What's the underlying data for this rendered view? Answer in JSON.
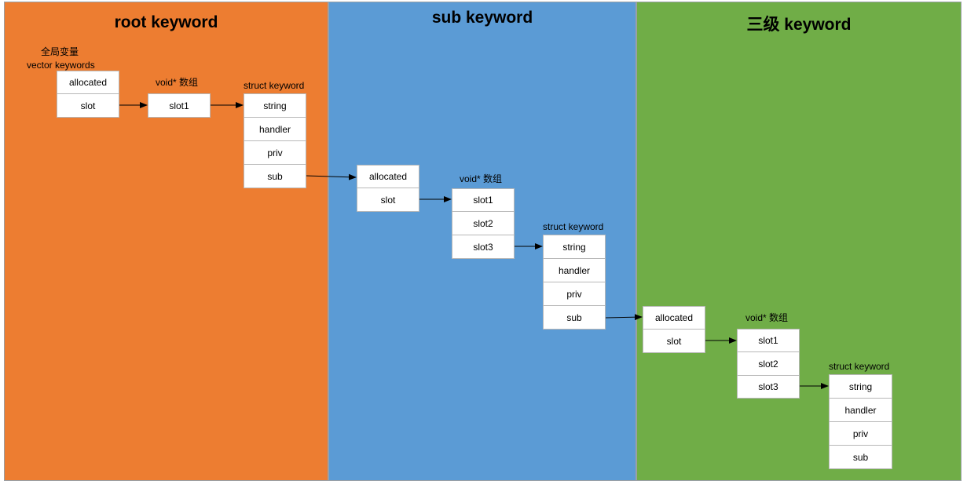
{
  "panels": {
    "root": {
      "title": "root keyword",
      "color": "#ed7d31"
    },
    "sub": {
      "title": "sub keyword",
      "color": "#5b9bd5"
    },
    "third": {
      "title": "三级 keyword",
      "color": "#70ad47"
    }
  },
  "root": {
    "global_label": "全局变量",
    "vector_label": "vector keywords",
    "vector_cells": [
      "allocated",
      "slot"
    ],
    "array_label": "void* 数组",
    "array_cells": [
      "slot1"
    ],
    "struct_label": "struct keyword",
    "struct_cells": [
      "string",
      "handler",
      "priv",
      "sub"
    ]
  },
  "sub": {
    "vector_cells": [
      "allocated",
      "slot"
    ],
    "array_label": "void* 数组",
    "array_cells": [
      "slot1",
      "slot2",
      "slot3"
    ],
    "struct_label": "struct keyword",
    "struct_cells": [
      "string",
      "handler",
      "priv",
      "sub"
    ]
  },
  "third": {
    "vector_cells": [
      "allocated",
      "slot"
    ],
    "array_label": "void* 数组",
    "array_cells": [
      "slot1",
      "slot2",
      "slot3"
    ],
    "struct_label": "struct keyword",
    "struct_cells": [
      "string",
      "handler",
      "priv",
      "sub"
    ]
  }
}
